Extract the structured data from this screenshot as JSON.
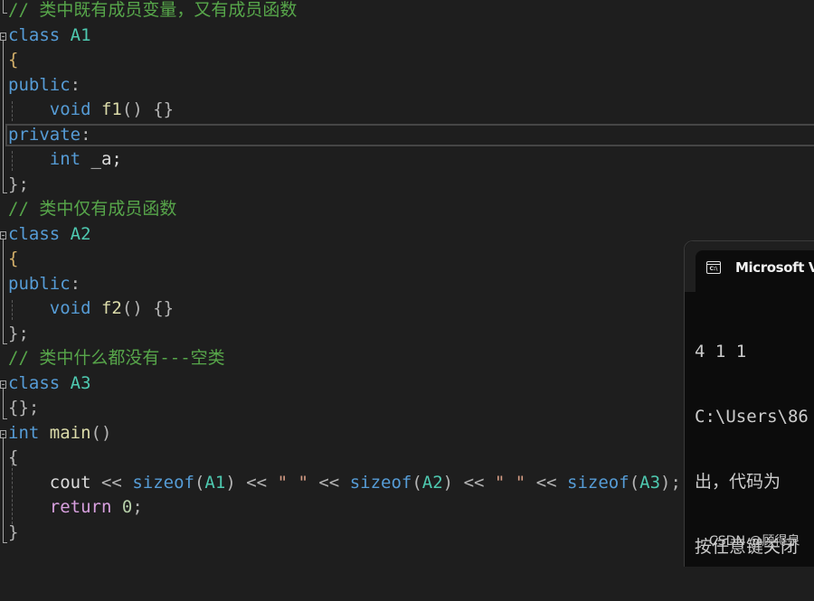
{
  "editor": {
    "lines": [
      {
        "comment": "// 类中既有成员变量，又有成员函数"
      },
      {
        "kw": "class",
        "name": "A1"
      },
      {
        "text": "{"
      },
      {
        "kw": "public",
        "punct": ":"
      },
      {
        "kw": "void",
        "fn": "f1",
        "rest": "() {}"
      },
      {
        "kw": "private",
        "punct": ":"
      },
      {
        "kw": "int",
        "rest": " _a;"
      },
      {
        "text": "};"
      },
      {
        "comment": "// 类中仅有成员函数"
      },
      {
        "kw": "class",
        "name": "A2"
      },
      {
        "text": "{"
      },
      {
        "kw": "public",
        "punct": ":"
      },
      {
        "kw": "void",
        "fn": "f2",
        "rest": "() {}"
      },
      {
        "text": "};"
      },
      {
        "comment": "// 类中什么都没有---空类"
      },
      {
        "kw": "class",
        "name": "A3"
      },
      {
        "text": "{};"
      },
      {
        "kw": "int",
        "fn": "main",
        "rest": "()"
      },
      {
        "text": "{"
      },
      {
        "cout": "cout",
        "op": "<<",
        "sizeof": "sizeof",
        "a1": "A1",
        "a2": "A2",
        "a3": "A3",
        "str": "\" \"",
        "semi": ";"
      },
      {
        "ctl": "return",
        "num": "0",
        "semi": ";"
      },
      {
        "text": "}"
      }
    ]
  },
  "console": {
    "title": "Microsoft Vis",
    "icon": "terminal-icon",
    "output": [
      "4 1 1",
      "C:\\Users\\86",
      "出，代码为",
      "按任意键关闭"
    ]
  },
  "watermark": "CSDN @顾得泉"
}
